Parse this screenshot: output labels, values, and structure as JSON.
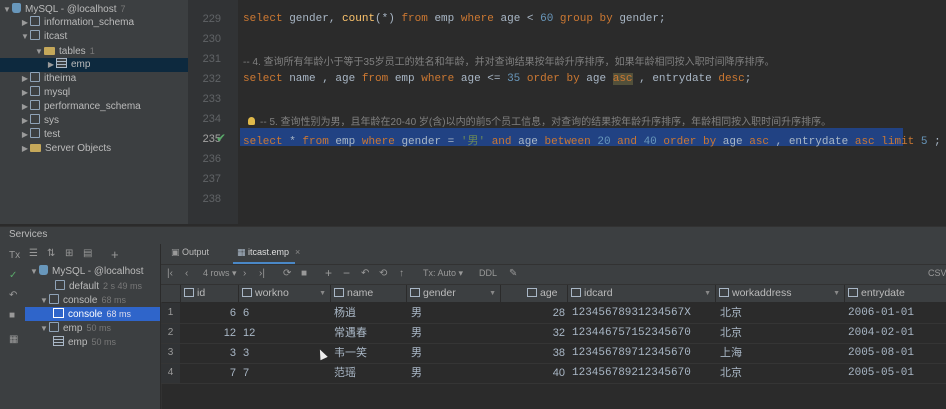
{
  "tree": {
    "connection": {
      "label": "MySQL - @localhost",
      "count": "7"
    },
    "schemas": [
      "information_schema",
      "itcast",
      "itheima",
      "mysql",
      "performance_schema",
      "sys",
      "test"
    ],
    "tables_folder": {
      "label": "tables",
      "count": "1"
    },
    "table": "emp",
    "server_objects": "Server Objects"
  },
  "editor": {
    "line_numbers": [
      "229",
      "230",
      "231",
      "232",
      "233",
      "234",
      "235",
      "236",
      "237",
      "238"
    ],
    "line_229": {
      "kw1": "select",
      "t1": " gender, ",
      "fn": "count",
      "t2": "(*) ",
      "kw2": "from",
      "t3": " emp ",
      "kw3": "where",
      "t4": " age < ",
      "num": "60",
      "t5": " ",
      "kw4": "group by",
      "t6": " gender;"
    },
    "line_231_comment": "-- 4. 查询所有年龄小于等于35岁员工的姓名和年龄，并对查询结果按年龄升序排序，如果年龄相同按入职时间降序排序。",
    "line_232": {
      "kw1": "select",
      "t1": " name , age ",
      "kw2": "from",
      "t2": " emp ",
      "kw3": "where",
      "t3": " age <= ",
      "num": "35",
      "t4": " ",
      "kw4": "order by",
      "t5": " age ",
      "kw5": "asc",
      "t6": " , entrydate ",
      "kw6": "desc",
      "t7": ";"
    },
    "line_234_comment": "-- 5. 查询性别为男，且年龄在20-40 岁(含)以内的前5个员工信息，对查询的结果按年龄升序排序，年龄相同按入职时间升序排序。",
    "line_235": {
      "kw1": "select",
      "t1": " * ",
      "kw2": "from",
      "t2": " emp ",
      "kw3": "where",
      "t3": " gender = ",
      "str": "'男'",
      "t4": " ",
      "kw4": "and",
      "t5": " age ",
      "kw5": "between",
      "t6": " ",
      "n1": "20",
      "t7": " ",
      "kw6": "and",
      "t8": " ",
      "n2": "40",
      "t9": " ",
      "kw7": "order by",
      "t10": " age ",
      "kw8": "asc",
      "t11": " , entrydate ",
      "kw9": "asc",
      "t12": " ",
      "kw10": "limit",
      "t13": " ",
      "n3": "5",
      "t14": " ;"
    }
  },
  "services": {
    "title": "Services",
    "tree": [
      {
        "label": "MySQL - @localhost",
        "hint": ""
      },
      {
        "label": "default",
        "hint": "2 s 49 ms"
      },
      {
        "label": "console",
        "hint": "68 ms"
      },
      {
        "label": "console",
        "hint": "68 ms"
      },
      {
        "label": "emp",
        "hint": "50 ms"
      },
      {
        "label": "emp",
        "hint": "50 ms"
      }
    ]
  },
  "results": {
    "tabs": [
      "Output",
      "itcast.emp"
    ],
    "rows_label": "4 rows",
    "tx_label": "Tx: Auto",
    "ddl_label": "DDL",
    "export_label": "CSV",
    "columns": [
      "id",
      "workno",
      "name",
      "gender",
      "age",
      "idcard",
      "workaddress",
      "entrydate"
    ],
    "rows": [
      [
        "6",
        "6",
        "杨逍",
        "男",
        "28",
        "12345678931234567X",
        "北京",
        "2006-01-01"
      ],
      [
        "12",
        "12",
        "常遇春",
        "男",
        "32",
        "123446757152345670",
        "北京",
        "2004-02-01"
      ],
      [
        "3",
        "3",
        "韦一笑",
        "男",
        "38",
        "123456789712345670",
        "上海",
        "2005-08-01"
      ],
      [
        "7",
        "7",
        "范瑶",
        "男",
        "40",
        "123456789212345670",
        "北京",
        "2005-05-01"
      ]
    ],
    "row_numbers": [
      "1",
      "2",
      "3",
      "4"
    ]
  },
  "colors": {
    "accent": "#4a88c7",
    "selection": "#214283",
    "keyword": "#cc7832",
    "number": "#6897bb",
    "string": "#6a8759"
  }
}
